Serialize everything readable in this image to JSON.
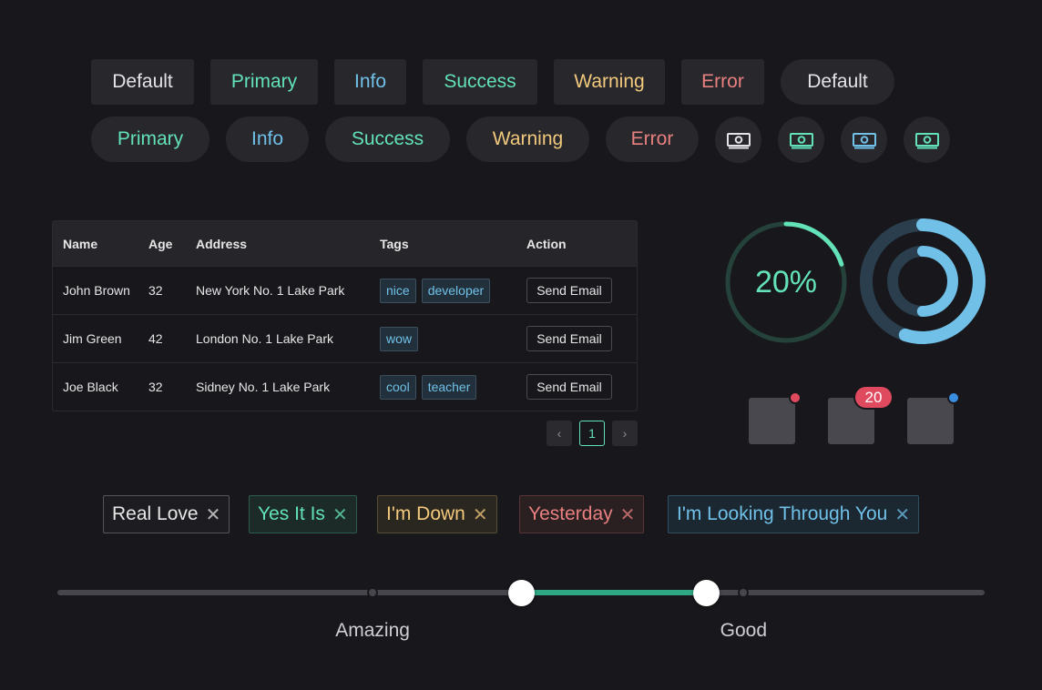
{
  "buttons": {
    "row1": [
      "Default",
      "Primary",
      "Info",
      "Success",
      "Warning",
      "Error",
      "Default"
    ],
    "row2": [
      "Primary",
      "Info",
      "Success",
      "Warning",
      "Error"
    ]
  },
  "icon_buttons": [
    "money-icon",
    "money-icon",
    "money-icon",
    "money-icon"
  ],
  "table": {
    "headers": [
      "Name",
      "Age",
      "Address",
      "Tags",
      "Action"
    ],
    "rows": [
      {
        "name": "John Brown",
        "age": "32",
        "address": "New York No. 1 Lake Park",
        "tags": [
          "nice",
          "developer"
        ],
        "action": "Send Email"
      },
      {
        "name": "Jim Green",
        "age": "42",
        "address": "London No. 1 Lake Park",
        "tags": [
          "wow"
        ],
        "action": "Send Email"
      },
      {
        "name": "Joe Black",
        "age": "32",
        "address": "Sidney No. 1 Lake Park",
        "tags": [
          "cool",
          "teacher"
        ],
        "action": "Send Email"
      }
    ]
  },
  "pagination": {
    "prev": "‹",
    "page": "1",
    "next": "›"
  },
  "progress": {
    "circle_percent": 20,
    "circle_label": "20%",
    "multi_outer": 0.55,
    "multi_inner": 0.5
  },
  "badges": {
    "count": "20"
  },
  "tags": [
    "Real Love",
    "Yes It Is",
    "I'm Down",
    "Yesterday",
    "I'm Looking Through You"
  ],
  "tag_close": "✕",
  "slider": {
    "range": [
      0.5,
      0.7
    ],
    "marks": [
      {
        "label": "Amazing",
        "value": 0.34
      },
      {
        "label": "Good",
        "value": 0.74
      }
    ]
  },
  "colors": {
    "primary": "#63e2b7",
    "info": "#70c0e8",
    "warning": "#f2c97d",
    "error": "#e88080",
    "background": "#18181c"
  }
}
